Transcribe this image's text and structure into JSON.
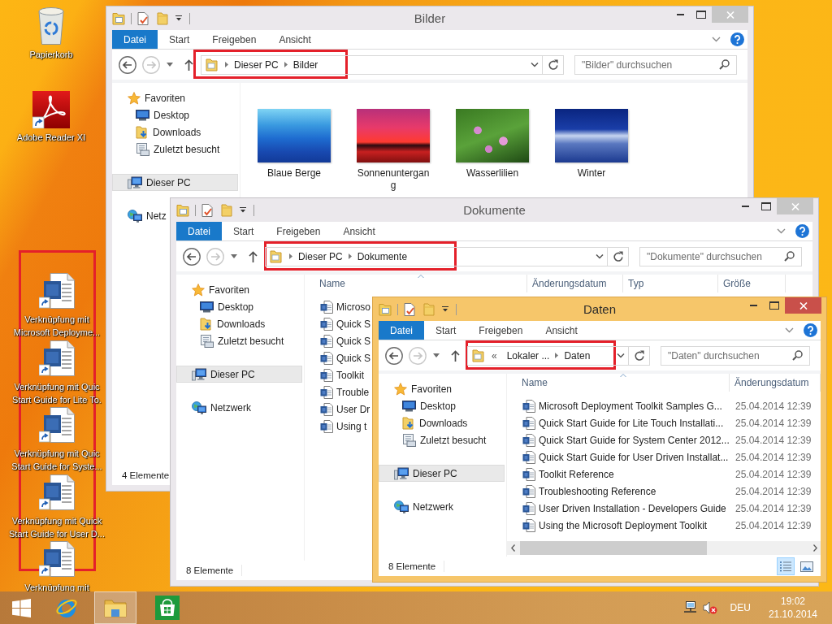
{
  "desktop": {
    "recycle_bin": {
      "label": "Papierkorb"
    },
    "reader_shortcut": {
      "label": "Adobe Reader XI"
    },
    "shortcuts": {
      "highlighted": true,
      "items": [
        {
          "label_lines": [
            "Verknüpfung mit",
            "Microsoft Deployme..."
          ]
        },
        {
          "label_lines": [
            "Verknüpfung mit Quic",
            "Start Guide for Lite To."
          ]
        },
        {
          "label_lines": [
            "Verknüpfung mit Quic",
            "Start Guide for Syste..."
          ]
        },
        {
          "label_lines": [
            "Verknüpfung mit Quick",
            "Start Guide for User D..."
          ]
        },
        {
          "label_lines": [
            "Verknüpfung mit"
          ]
        }
      ]
    }
  },
  "windows": [
    {
      "title": "Bilder",
      "active": false,
      "tabs": [
        {
          "label": "Datei",
          "kind": "file"
        },
        {
          "label": "Start",
          "kind": "tab"
        },
        {
          "label": "Freigeben",
          "kind": "tab"
        },
        {
          "label": "Ansicht",
          "kind": "tab"
        }
      ],
      "address": {
        "highlighted": true,
        "crumbs": [
          "Dieser PC",
          "Bilder"
        ]
      },
      "search": {
        "placeholder": "\"Bilder\" durchsuchen"
      },
      "nav": [
        {
          "label": "Favoriten",
          "selected": false,
          "children": [
            {
              "label": "Desktop",
              "selected": false
            },
            {
              "label": "Downloads",
              "selected": false
            },
            {
              "label": "Zuletzt besucht",
              "selected": false
            }
          ]
        },
        {
          "label": "Dieser PC",
          "selected": true
        },
        {
          "label": "Netz",
          "selected": false
        }
      ],
      "content": {
        "kind": "thumbnails",
        "items": [
          {
            "label": "Blaue Berge"
          },
          {
            "label": "Sonnenuntergang"
          },
          {
            "label": "Wasserlilien"
          },
          {
            "label": "Winter"
          }
        ]
      },
      "status": "4 Elemente"
    },
    {
      "title": "Dokumente",
      "active": false,
      "tabs": [
        {
          "label": "Datei",
          "kind": "file"
        },
        {
          "label": "Start",
          "kind": "tab"
        },
        {
          "label": "Freigeben",
          "kind": "tab"
        },
        {
          "label": "Ansicht",
          "kind": "tab"
        }
      ],
      "address": {
        "highlighted": true,
        "crumbs": [
          "Dieser PC",
          "Dokumente"
        ]
      },
      "search": {
        "placeholder": "\"Dokumente\" durchsuchen"
      },
      "nav": [
        {
          "label": "Favoriten",
          "selected": false,
          "children": [
            {
              "label": "Desktop",
              "selected": false
            },
            {
              "label": "Downloads",
              "selected": false
            },
            {
              "label": "Zuletzt besucht",
              "selected": false
            }
          ]
        },
        {
          "label": "Dieser PC",
          "selected": true
        },
        {
          "label": "Netzwerk",
          "selected": false
        }
      ],
      "content": {
        "kind": "details",
        "columns": [
          {
            "label": "Name",
            "sorted": true
          },
          {
            "label": "Änderungsdatum",
            "sorted": false
          },
          {
            "label": "Typ",
            "sorted": false
          },
          {
            "label": "Größe",
            "sorted": false
          }
        ],
        "rows": [
          {
            "name": "Microso"
          },
          {
            "name": "Quick S"
          },
          {
            "name": "Quick S"
          },
          {
            "name": "Quick S"
          },
          {
            "name": "Toolkit"
          },
          {
            "name": "Trouble"
          },
          {
            "name": "User Dr"
          },
          {
            "name": "Using t"
          }
        ]
      },
      "status": "8 Elemente"
    },
    {
      "title": "Daten",
      "active": true,
      "tabs": [
        {
          "label": "Datei",
          "kind": "file"
        },
        {
          "label": "Start",
          "kind": "tab"
        },
        {
          "label": "Freigeben",
          "kind": "tab"
        },
        {
          "label": "Ansicht",
          "kind": "tab"
        }
      ],
      "address": {
        "highlighted": true,
        "overflow_marker": "«",
        "crumbs": [
          "Lokaler ...",
          "Daten"
        ]
      },
      "search": {
        "placeholder": "\"Daten\" durchsuchen"
      },
      "nav": [
        {
          "label": "Favoriten",
          "selected": false,
          "children": [
            {
              "label": "Desktop",
              "selected": false
            },
            {
              "label": "Downloads",
              "selected": false
            },
            {
              "label": "Zuletzt besucht",
              "selected": false
            }
          ]
        },
        {
          "label": "Dieser PC",
          "selected": true
        },
        {
          "label": "Netzwerk",
          "selected": false
        }
      ],
      "content": {
        "kind": "details",
        "horizontal_scrollbar": true,
        "columns": [
          {
            "label": "Name",
            "sorted": true
          },
          {
            "label": "Änderungsdatum",
            "sorted": false
          }
        ],
        "rows": [
          {
            "name": "Microsoft Deployment Toolkit Samples G...",
            "modified": "25.04.2014 12:39"
          },
          {
            "name": "Quick Start Guide for Lite Touch Installati...",
            "modified": "25.04.2014 12:39"
          },
          {
            "name": "Quick Start Guide for System Center 2012...",
            "modified": "25.04.2014 12:39"
          },
          {
            "name": "Quick Start Guide for User Driven Installat...",
            "modified": "25.04.2014 12:39"
          },
          {
            "name": "Toolkit Reference",
            "modified": "25.04.2014 12:39"
          },
          {
            "name": "Troubleshooting Reference",
            "modified": "25.04.2014 12:39"
          },
          {
            "name": "User Driven Installation - Developers Guide",
            "modified": "25.04.2014 12:39"
          },
          {
            "name": "Using the Microsoft Deployment Toolkit",
            "modified": "25.04.2014 12:39"
          }
        ]
      },
      "status": "8 Elemente",
      "view_buttons": [
        {
          "selected": true
        },
        {
          "selected": false
        }
      ]
    }
  ],
  "taskbar": {
    "apps": [
      {
        "running": false
      },
      {
        "running": true
      },
      {
        "running": false
      }
    ],
    "tray": {
      "volume_muted": true,
      "language": "DEU",
      "time": "19:02",
      "date": "21.10.2014"
    }
  }
}
